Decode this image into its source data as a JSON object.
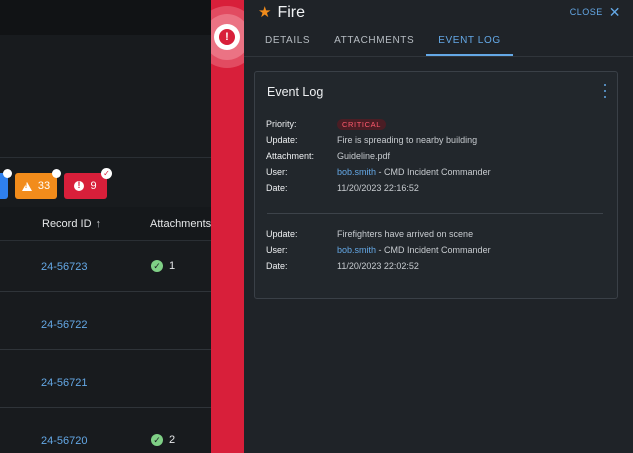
{
  "background_list": {
    "badges": [
      {
        "label": "",
        "color": "#2f80ed"
      },
      {
        "label": "33",
        "color": "#f28c1b"
      },
      {
        "label": "9",
        "color": "#d81f3a"
      }
    ],
    "columns": {
      "record_id": "Record ID",
      "attachments": "Attachments"
    },
    "rows": [
      {
        "record_id": "24-56723",
        "attachments": "1"
      },
      {
        "record_id": "24-56722",
        "attachments": ""
      },
      {
        "record_id": "24-56721",
        "attachments": ""
      },
      {
        "record_id": "24-56720",
        "attachments": "2"
      }
    ]
  },
  "panel": {
    "title": "Fire",
    "close_label": "CLOSE",
    "tabs": [
      {
        "label": "DETAILS",
        "active": false
      },
      {
        "label": "ATTACHMENTS",
        "active": false
      },
      {
        "label": "EVENT LOG",
        "active": true
      }
    ],
    "card": {
      "title": "Event Log",
      "entries": [
        {
          "priority_label": "Priority:",
          "priority_value": "CRITICAL",
          "update_label": "Update:",
          "update_value": "Fire is spreading to nearby building",
          "attachment_label": "Attachment:",
          "attachment_value": "Guideline.pdf",
          "user_label": "User:",
          "user_name": "bob.smith",
          "user_role": " - CMD Incident Commander",
          "date_label": "Date:",
          "date_value": "11/20/2023 22:16:52"
        },
        {
          "update_label": "Update:",
          "update_value": "Firefighters have arrived on scene",
          "user_label": "User:",
          "user_name": "bob.smith",
          "user_role": " - CMD Incident Commander",
          "date_label": "Date:",
          "date_value": "11/20/2023 22:02:52"
        }
      ]
    }
  },
  "colors": {
    "accent": "#64a8e6",
    "alert_red": "#d81f3a",
    "warning_orange": "#f28c1b",
    "success_green": "#7fd086"
  }
}
